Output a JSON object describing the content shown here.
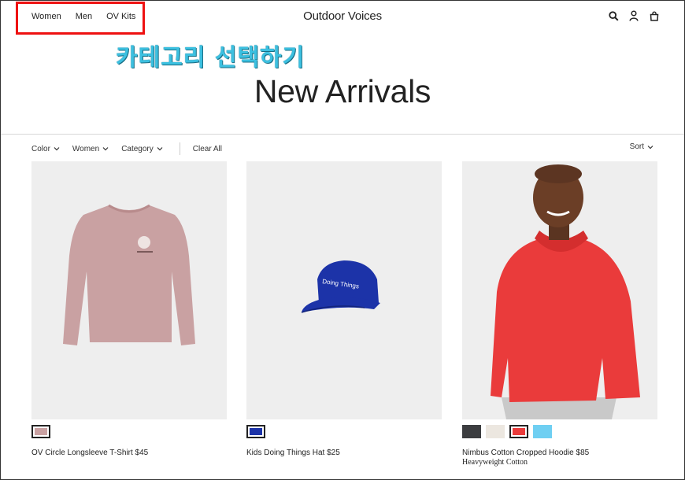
{
  "nav": {
    "items": [
      "Women",
      "Men",
      "OV Kits"
    ],
    "brand": "Outdoor Voices"
  },
  "annotation": {
    "text": "카테고리 선택하기",
    "color": "#3cc0e0",
    "box_color": "#ee1111"
  },
  "header_icons": [
    "search-icon",
    "account-icon",
    "bag-icon"
  ],
  "page": {
    "title": "New Arrivals"
  },
  "filters": {
    "items": [
      "Color",
      "Women",
      "Category"
    ],
    "clear": "Clear All",
    "sort": "Sort"
  },
  "products": [
    {
      "name": "OV Circle Longsleeve T-Shirt $45",
      "subtitle": "",
      "swatches": [
        "#c9a1a2"
      ],
      "selected": 0
    },
    {
      "name": "Kids Doing Things Hat $25",
      "subtitle": "",
      "swatches": [
        "#1c33a8"
      ],
      "selected": 0,
      "print": "Doing Things"
    },
    {
      "name": "Nimbus Cotton Cropped Hoodie $85",
      "subtitle": "Heavyweight Cotton",
      "swatches": [
        "#3c3d40",
        "#ece7e0",
        "#ea3b3b",
        "#6fcff2"
      ],
      "selected": 2
    }
  ]
}
